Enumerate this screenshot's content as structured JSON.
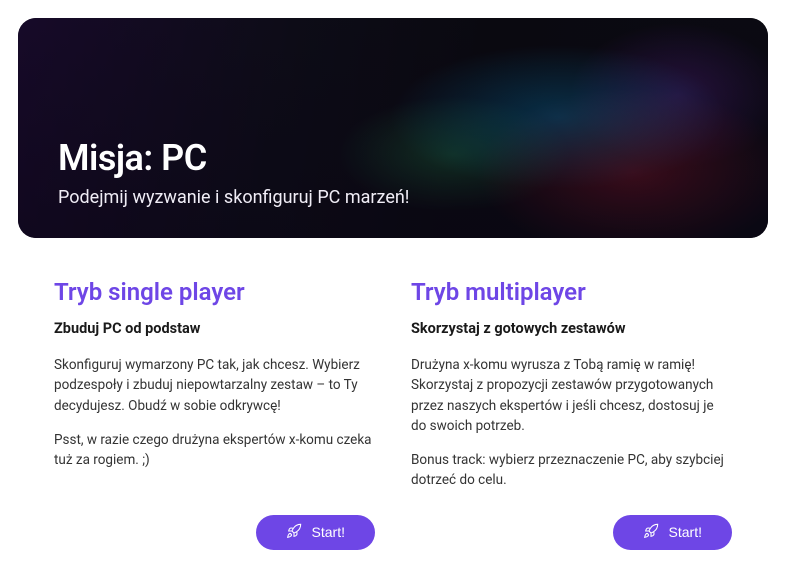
{
  "hero": {
    "title": "Misja: PC",
    "subtitle": "Podejmij wyzwanie i skonfiguruj PC marzeń!"
  },
  "modes": {
    "single": {
      "title": "Tryb single player",
      "subtitle": "Zbuduj PC od podstaw",
      "p1": "Skonfiguruj wymarzony PC tak, jak chcesz. Wybierz podzespoły i zbuduj niepowtarzalny zestaw – to Ty decydujesz. Obudź w sobie odkrywcę!",
      "p2": "Psst, w razie czego drużyna ekspertów x-komu czeka tuż za rogiem. ;)",
      "button": "Start!"
    },
    "multi": {
      "title": "Tryb multiplayer",
      "subtitle": "Skorzystaj z gotowych zestawów",
      "p1": "Drużyna x-komu wyrusza z Tobą ramię w ramię! Skorzystaj z propozycji zestawów przygotowanych przez naszych ekspertów i jeśli chcesz, dostosuj je do swoich potrzeb.",
      "p2": "Bonus track: wybierz przeznaczenie PC, aby szybciej dotrzeć do celu.",
      "button": "Start!"
    }
  },
  "colors": {
    "accent": "#6E46E6"
  }
}
